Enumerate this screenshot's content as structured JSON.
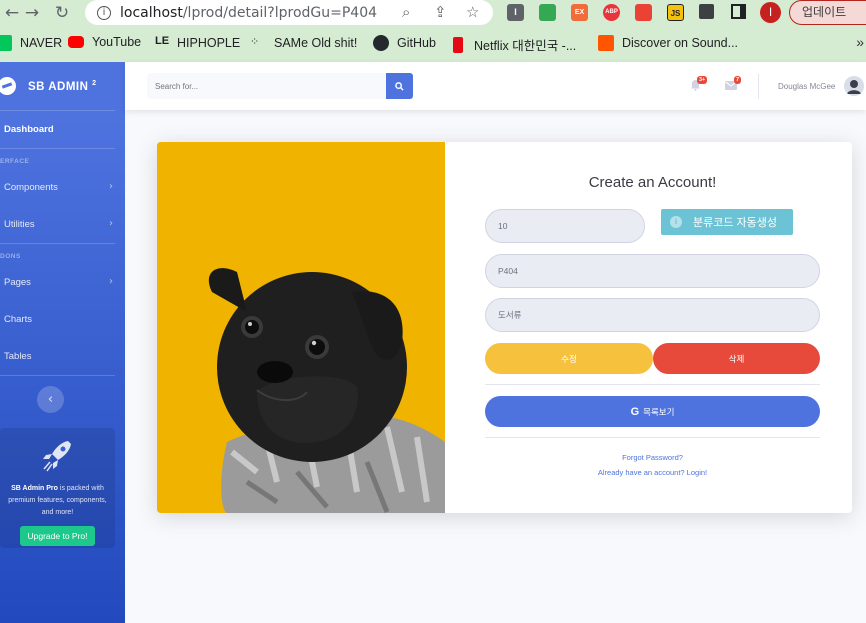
{
  "browser": {
    "url_host": "localhost",
    "url_path": "/lprod/detail?lprodGu=P404",
    "update_label": "업데이트",
    "profile_initial": "I",
    "extensions": [
      {
        "name": "extension-i",
        "label": "I",
        "color": "#5f6368"
      },
      {
        "name": "extension-screen",
        "label": "",
        "color": "#34a853"
      },
      {
        "name": "extension-ex",
        "label": "EX",
        "color": "#f26b3a"
      },
      {
        "name": "extension-abp",
        "label": "ABP",
        "color": "#e8343b"
      },
      {
        "name": "extension-box",
        "label": "",
        "color": "#ea4335"
      },
      {
        "name": "extension-js",
        "label": "JS",
        "color": "#f4c20d"
      }
    ]
  },
  "bookmarks": [
    {
      "label": "NAVER",
      "icon": "naver-icon",
      "color": "#03c75a"
    },
    {
      "label": "YouTube",
      "icon": "youtube-icon",
      "color": "#ff0000"
    },
    {
      "label": "HIPHOPLE",
      "icon": "hiphople-icon",
      "color": "#111111"
    },
    {
      "label": "SAMe Old shit!",
      "icon": "dots-icon",
      "color": "#333333"
    },
    {
      "label": "GitHub",
      "icon": "github-icon",
      "color": "#24292e"
    },
    {
      "label": "Netflix 대한민국 -...",
      "icon": "netflix-icon",
      "color": "#e50914"
    },
    {
      "label": "Discover on Sound...",
      "icon": "soundcloud-icon",
      "color": "#ff5500"
    }
  ],
  "sidebar": {
    "brand": "SB ADMIN",
    "brand_sup": "2",
    "dashboard": "Dashboard",
    "heading_interface": "ERFACE",
    "components": "Components",
    "utilities": "Utilities",
    "heading_addons": "DONS",
    "pages": "Pages",
    "charts": "Charts",
    "tables": "Tables",
    "promo_brand": "SB Admin Pro",
    "promo_text": " is packed with premium features, components, and more!",
    "promo_button": "Upgrade to Pro!"
  },
  "topbar": {
    "search_placeholder": "Search for...",
    "alerts_count": "3+",
    "messages_count": "7",
    "user_name": "Douglas McGee"
  },
  "form": {
    "title": "Create an Account!",
    "code_value": "10",
    "auto_button": "분류코드 자동생성",
    "lprod_gu": "P404",
    "lprod_name": "도서류",
    "edit_button": "수정",
    "delete_button": "삭제",
    "list_button": "목록보기",
    "list_button_icon": "G",
    "forgot_link": "Forgot Password?",
    "login_link": "Already have an account? Login!"
  },
  "colors": {
    "primary": "#4e73df",
    "warning": "#f6c23e",
    "danger": "#e74a3b",
    "info": "#6cc3d6",
    "success": "#1cc88a"
  }
}
